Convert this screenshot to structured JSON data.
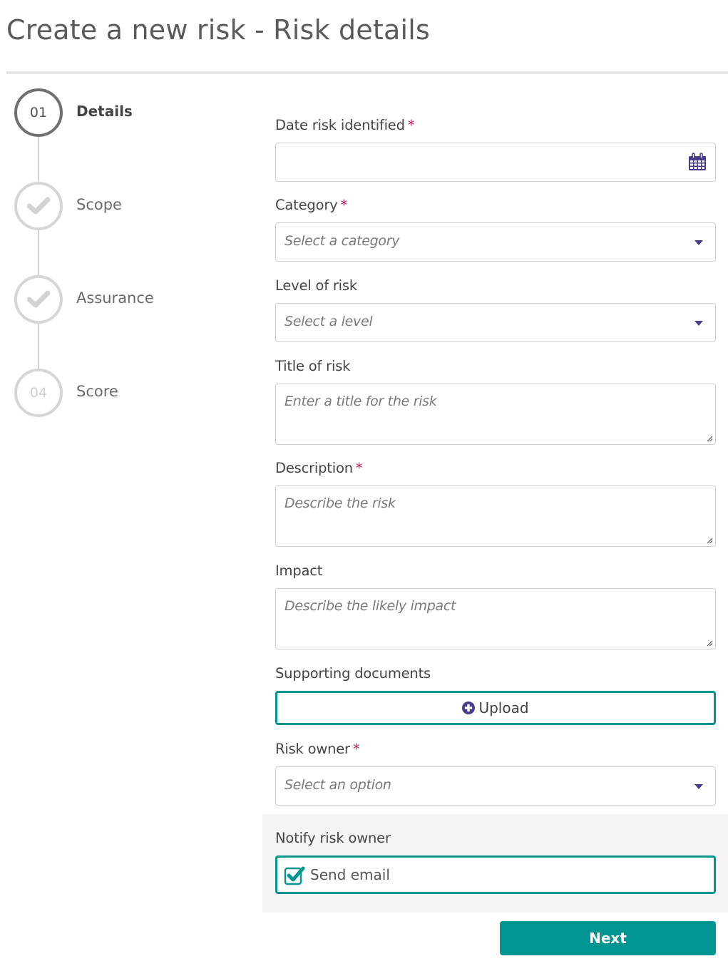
{
  "page": {
    "title": "Create a new risk - Risk details"
  },
  "stepper": {
    "steps": [
      {
        "number": "01",
        "label": "Details",
        "state": "active"
      },
      {
        "number": "",
        "label": "Scope",
        "state": "complete"
      },
      {
        "number": "",
        "label": "Assurance",
        "state": "complete"
      },
      {
        "number": "04",
        "label": "Score",
        "state": "pending"
      }
    ]
  },
  "form": {
    "date_identified": {
      "label": "Date risk identified",
      "required": "*",
      "value": "",
      "icon": "calendar-icon"
    },
    "category": {
      "label": "Category",
      "required": "*",
      "placeholder": "Select a category",
      "icon": "caret-down-icon"
    },
    "level": {
      "label": "Level of risk",
      "placeholder": "Select a level",
      "icon": "caret-down-icon"
    },
    "title": {
      "label": "Title of risk",
      "placeholder": "Enter a title for the risk"
    },
    "description": {
      "label": "Description",
      "required": "*",
      "placeholder": "Describe the risk"
    },
    "impact": {
      "label": "Impact",
      "placeholder": "Describe the likely impact"
    },
    "documents": {
      "label": "Supporting documents",
      "upload_label": "Upload",
      "icon": "plus-circle-icon"
    },
    "owner": {
      "label": "Risk owner",
      "required": "*",
      "placeholder": "Select an option",
      "icon": "caret-down-icon"
    },
    "notify": {
      "label": "Notify risk owner",
      "checkbox_label": "Send email",
      "checked": true
    }
  },
  "actions": {
    "next_label": "Next"
  },
  "colors": {
    "accent_teal": "#009590",
    "icon_purple": "#4a3b8c",
    "required_pink": "#c2185b",
    "panel_bg": "#f6f4f5"
  }
}
